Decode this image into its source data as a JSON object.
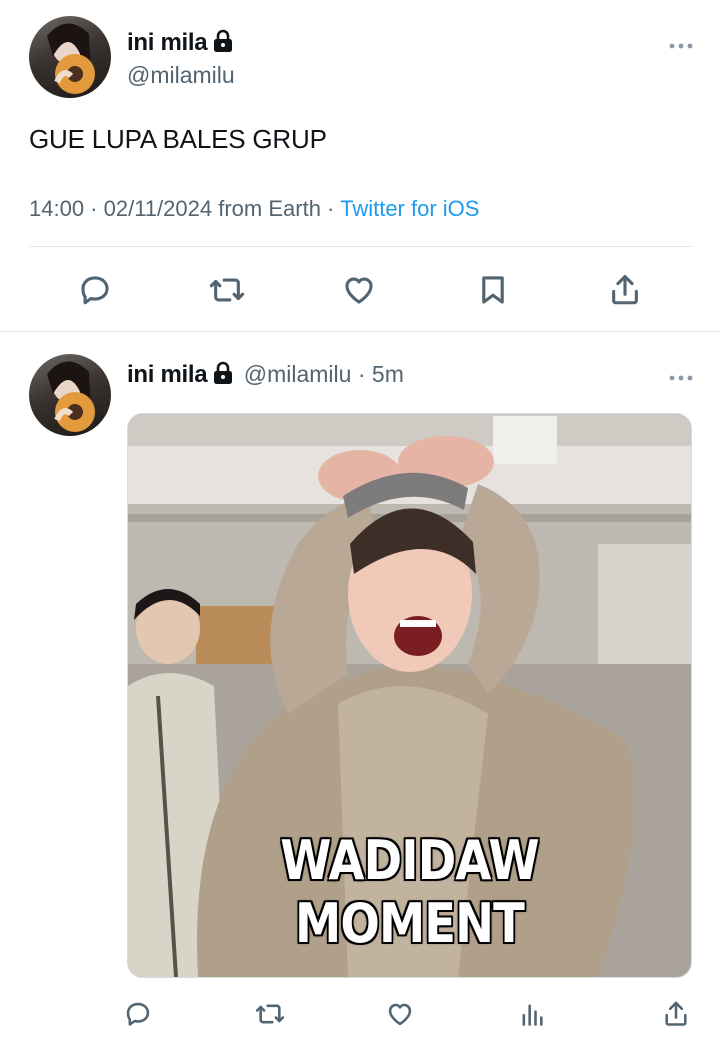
{
  "main_tweet": {
    "author_name": "ini mila",
    "author_handle": "@milamilu",
    "text": "GUE LUPA BALES GRUP",
    "time": "14:00",
    "date": "02/11/2024",
    "location": "from Earth",
    "source": "Twitter for iOS",
    "icons": [
      "reply-icon",
      "retweet-icon",
      "like-icon",
      "bookmark-icon",
      "share-icon"
    ]
  },
  "reply_tweet": {
    "author_name": "ini mila",
    "author_handle": "@milamilu",
    "age": "5m",
    "media_caption": "WADIDAW MOMENT",
    "icons": [
      "reply-icon",
      "retweet-icon",
      "like-icon",
      "analytics-icon",
      "share-icon"
    ]
  },
  "colors": {
    "link": "#1d9bf0",
    "secondary_text": "#536471",
    "divider": "#e3e7ea"
  }
}
